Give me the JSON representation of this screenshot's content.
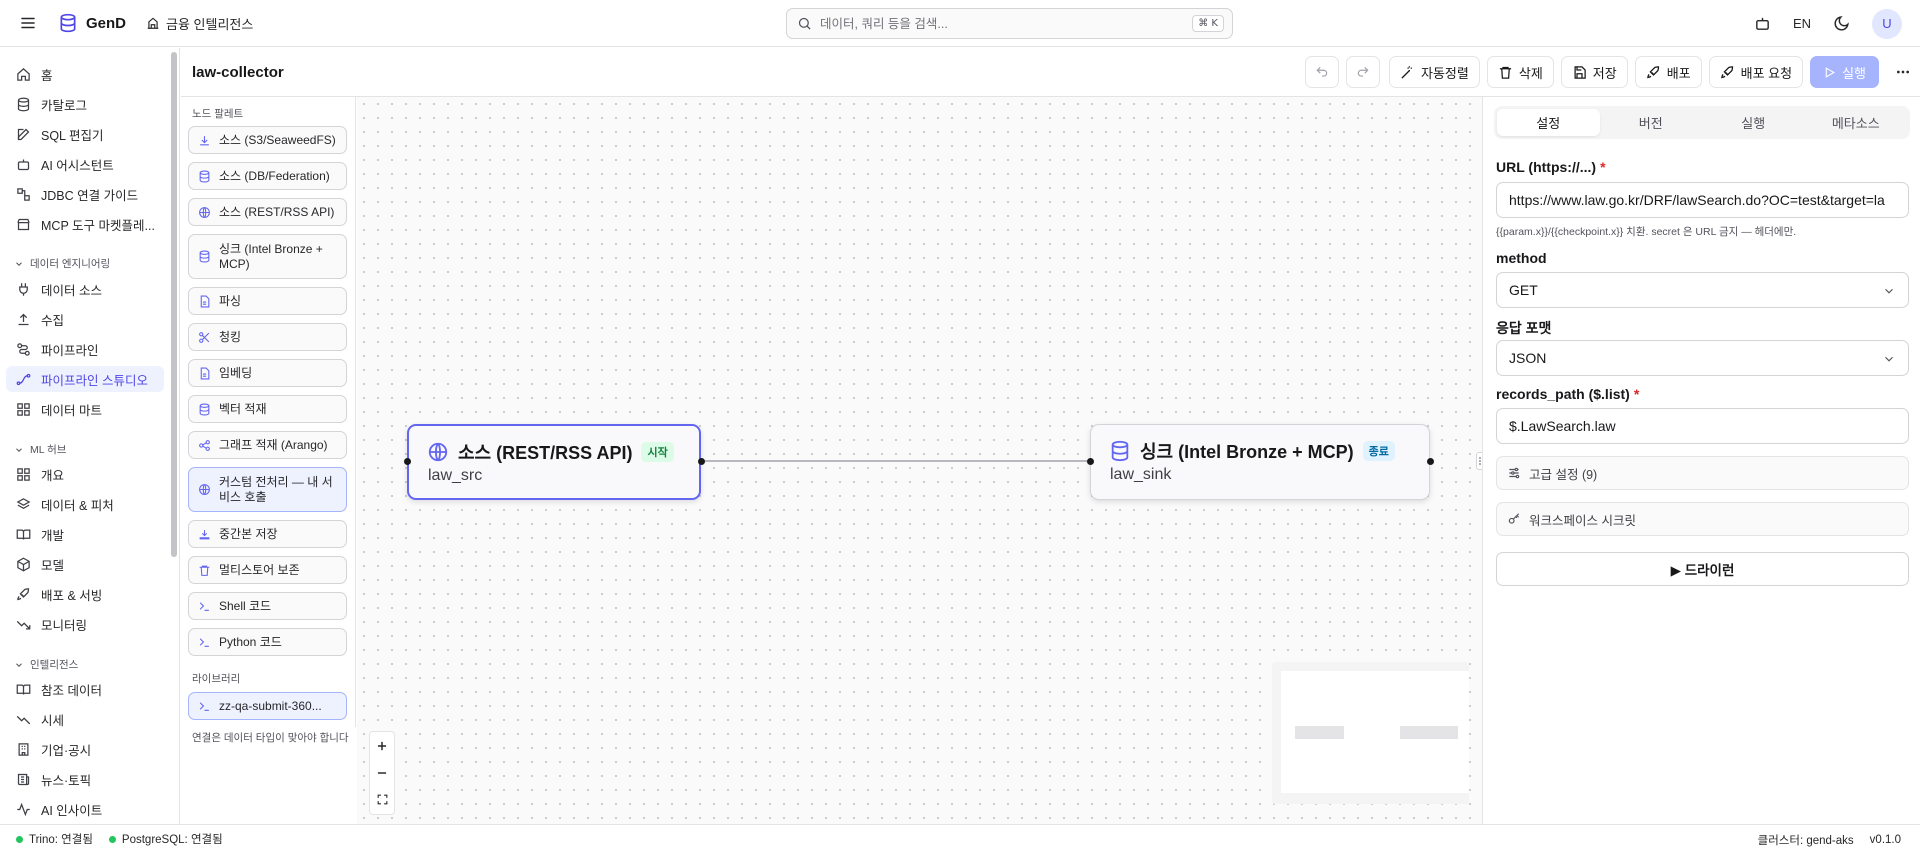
{
  "topbar": {
    "brand": "GenD",
    "workspace": "금융 인텔리전스",
    "search_placeholder": "데이터, 쿼리 등을 검색...",
    "search_shortcut": "⌘ K",
    "language": "EN",
    "avatar_initial": "U"
  },
  "sidebar": {
    "items": [
      {
        "label": "홈",
        "icon": "home-icon"
      },
      {
        "label": "카탈로그",
        "icon": "database-icon"
      },
      {
        "label": "SQL 편집기",
        "icon": "edit-icon"
      },
      {
        "label": "AI 어시스턴트",
        "icon": "bot-icon"
      },
      {
        "label": "JDBC 연결 가이드",
        "icon": "plug-icon"
      },
      {
        "label": "MCP 도구 마켓플레...",
        "icon": "store-icon"
      }
    ],
    "groups": [
      {
        "label": "데이터 엔지니어링",
        "items": [
          {
            "label": "데이터 소스",
            "icon": "plug-icon"
          },
          {
            "label": "수집",
            "icon": "upload-icon"
          },
          {
            "label": "파이프라인",
            "icon": "workflow-icon"
          },
          {
            "label": "파이프라인 스튜디오",
            "icon": "spline-icon"
          },
          {
            "label": "데이터 마트",
            "icon": "grid-icon"
          }
        ]
      },
      {
        "label": "ML 허브",
        "items": [
          {
            "label": "개요",
            "icon": "grid-icon"
          },
          {
            "label": "데이터 & 피처",
            "icon": "layers-icon"
          },
          {
            "label": "개발",
            "icon": "book-icon"
          },
          {
            "label": "모델",
            "icon": "box-icon"
          },
          {
            "label": "배포 & 서빙",
            "icon": "rocket-icon"
          },
          {
            "label": "모니터링",
            "icon": "trending-down-icon"
          }
        ]
      },
      {
        "label": "인텔리전스",
        "items": [
          {
            "label": "참조 데이터",
            "icon": "book-icon"
          },
          {
            "label": "시세",
            "icon": "trending-icon"
          },
          {
            "label": "기업·공시",
            "icon": "building-icon"
          },
          {
            "label": "뉴스·토픽",
            "icon": "newspaper-icon"
          },
          {
            "label": "AI 인사이트",
            "icon": "activity-icon"
          }
        ]
      }
    ]
  },
  "header": {
    "title": "law-collector",
    "actions": {
      "auto_layout": "자동정렬",
      "delete": "삭제",
      "save": "저장",
      "deploy": "배포",
      "deploy_request": "배포 요청",
      "run": "실행"
    }
  },
  "palette": {
    "section_label": "노드 팔레트",
    "items": [
      {
        "label": "소스 (S3/SeaweedFS)",
        "icon": "download-icon"
      },
      {
        "label": "소스 (DB/Federation)",
        "icon": "database-icon"
      },
      {
        "label": "소스 (REST/RSS API)",
        "icon": "globe-icon"
      },
      {
        "label": "싱크 (Intel Bronze + MCP)",
        "icon": "database-icon"
      },
      {
        "label": "파싱",
        "icon": "file-icon"
      },
      {
        "label": "청킹",
        "icon": "scissors-icon"
      },
      {
        "label": "임베딩",
        "icon": "file-icon"
      },
      {
        "label": "벡터 적재",
        "icon": "database-icon"
      },
      {
        "label": "그래프 적재 (Arango)",
        "icon": "share-icon"
      },
      {
        "label": "커스텀 전처리 — 내 서비스 호출",
        "icon": "globe-icon"
      },
      {
        "label": "중간본 저장",
        "icon": "save-icon"
      },
      {
        "label": "멀티스토어 보존",
        "icon": "archive-icon"
      },
      {
        "label": "Shell 코드",
        "icon": "terminal-icon"
      },
      {
        "label": "Python 코드",
        "icon": "terminal-icon"
      }
    ],
    "library_label": "라이브러리",
    "library_items": [
      {
        "label": "zz-qa-submit-360...",
        "icon": "terminal-icon"
      }
    ],
    "hint": "연결은 데이터 타입이 맞아야 합니다"
  },
  "canvas": {
    "nodes": [
      {
        "title": "소스 (REST/RSS API)",
        "badge": "시작",
        "name": "law_src",
        "icon": "globe-icon"
      },
      {
        "title": "싱크 (Intel Bronze + MCP)",
        "badge": "종료",
        "name": "law_sink",
        "icon": "database-icon"
      }
    ]
  },
  "panel": {
    "tabs": [
      "설정",
      "버전",
      "실행",
      "메타소스"
    ],
    "active_tab": "설정",
    "fields": {
      "url_label": "URL (https://...)",
      "url_value": "https://www.law.go.kr/DRF/lawSearch.do?OC=test&target=la",
      "url_help": "{{param.x}}/{{checkpoint.x}} 치환. secret 은 URL 금지 — 헤더에만.",
      "method_label": "method",
      "method_value": "GET",
      "format_label": "응답 포맷",
      "format_value": "JSON",
      "records_label": "records_path ($.list)",
      "records_value": "$.LawSearch.law"
    },
    "advanced": "고급 설정 (9)",
    "secrets": "워크스페이스 시크릿",
    "dry_run": "▶ 드라이런"
  },
  "status": {
    "trino": "Trino: 연결됨",
    "postgres": "PostgreSQL: 연결됨",
    "cluster": "클러스터: gend-aks",
    "version": "v0.1.0"
  },
  "colors": {
    "accent": "#6366f1",
    "accent_bg": "#eef2ff",
    "run_button": "#a5b4fc",
    "connected": "#22c55e",
    "required": "#dc2626"
  }
}
